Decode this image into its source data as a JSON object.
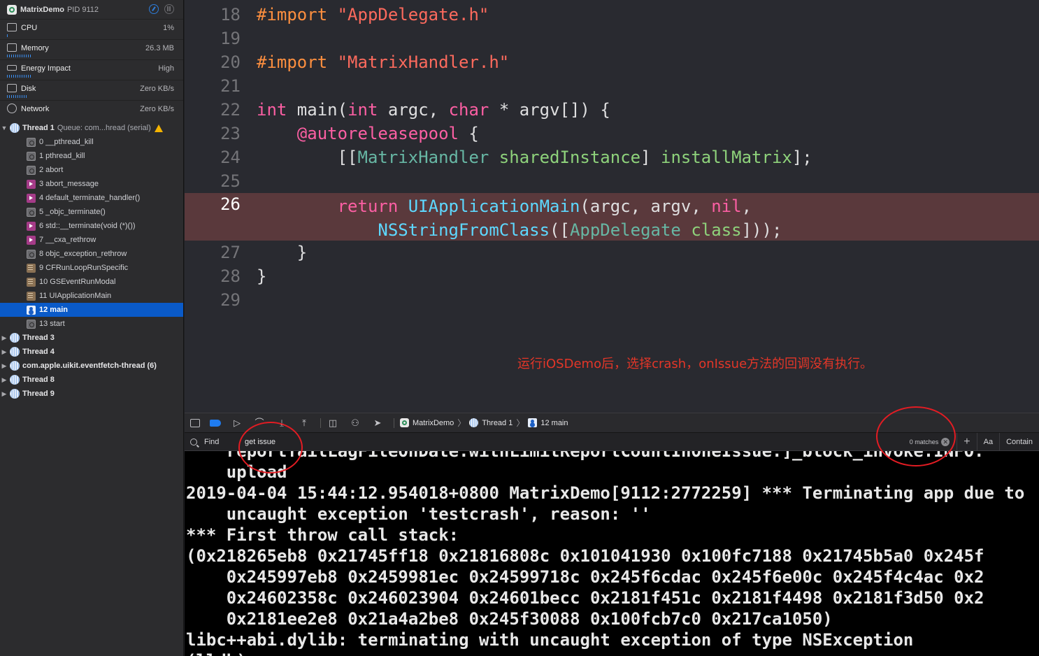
{
  "process": {
    "name": "MatrixDemo",
    "pid_label": "PID 9112"
  },
  "gauges": [
    {
      "label": "CPU",
      "value": "1%",
      "bar_level": 0.01
    },
    {
      "label": "Memory",
      "value": "26.3 MB",
      "bar_level": 0.14
    },
    {
      "label": "Energy Impact",
      "value": "High",
      "bar_level": 0.13
    },
    {
      "label": "Disk",
      "value": "Zero KB/s",
      "bar_level": 0.12
    },
    {
      "label": "Network",
      "value": "Zero KB/s",
      "bar_level": 0
    }
  ],
  "thread1": {
    "label": "Thread 1",
    "queue": "Queue: com...hread (serial)"
  },
  "frames": [
    {
      "label": "0 __pthread_kill",
      "kind": "sys"
    },
    {
      "label": "1 pthread_kill",
      "kind": "sys"
    },
    {
      "label": "2 abort",
      "kind": "sys"
    },
    {
      "label": "3 abort_message",
      "kind": "lib"
    },
    {
      "label": "4 default_terminate_handler()",
      "kind": "lib"
    },
    {
      "label": "5 _objc_terminate()",
      "kind": "sys"
    },
    {
      "label": "6 std::__terminate(void (*)())",
      "kind": "lib"
    },
    {
      "label": "7 __cxa_rethrow",
      "kind": "lib"
    },
    {
      "label": "8 objc_exception_rethrow",
      "kind": "sys"
    },
    {
      "label": "9 CFRunLoopRunSpecific",
      "kind": "fw"
    },
    {
      "label": "10 GSEventRunModal",
      "kind": "fw"
    },
    {
      "label": "11 UIApplicationMain",
      "kind": "fw"
    },
    {
      "label": "12 main",
      "kind": "user",
      "selected": true
    },
    {
      "label": "13 start",
      "kind": "sys"
    }
  ],
  "other_threads": [
    "Thread 3",
    "Thread 4",
    "com.apple.uikit.eventfetch-thread (6)",
    "Thread 8",
    "Thread 9"
  ],
  "editor": {
    "line_numbers": [
      "18",
      "19",
      "20",
      "21",
      "22",
      "23",
      "24",
      "25",
      "26",
      "27",
      "28",
      "29"
    ],
    "current_line": "26",
    "import1_kw": "#import",
    "import1_file": "\"AppDelegate.h\"",
    "import2_kw": "#import",
    "import2_file": "\"MatrixHandler.h\"",
    "note": "运行iOSDemo后，选择crash，onIssue方法的回调没有执行。"
  },
  "debugbar": {
    "crumbs": [
      "MatrixDemo",
      "Thread 1",
      "12 main"
    ]
  },
  "findbar": {
    "scope": "Find",
    "query": "get issue",
    "matches": "0 matches",
    "case_label": "Aa",
    "mode_label": "Contain"
  },
  "console": {
    "lines": [
      "    reportTailLagFileOnDate:withLimitReportCountInOneIssue:]_block_invoke:INFO:",
      "    upload",
      "2019-04-04 15:44:12.954018+0800 MatrixDemo[9112:2772259] *** Terminating app due to",
      "    uncaught exception 'testcrash', reason: ''",
      "*** First throw call stack:",
      "(0x218265eb8 0x21745ff18 0x21816808c 0x101041930 0x100fc7188 0x21745b5a0 0x245f",
      "    0x245997eb8 0x2459981ec 0x24599718c 0x245f6cdac 0x245f6e00c 0x245f4c4ac 0x2",
      "    0x24602358c 0x246023904 0x24601becc 0x2181f451c 0x2181f4498 0x2181f3d50 0x2",
      "    0x2181ee2e8 0x21a4a2be8 0x245f30088 0x100fcb7c0 0x217ca1050)",
      "libc++abi.dylib: terminating with uncaught exception of type NSException",
      "(lldb)"
    ]
  }
}
